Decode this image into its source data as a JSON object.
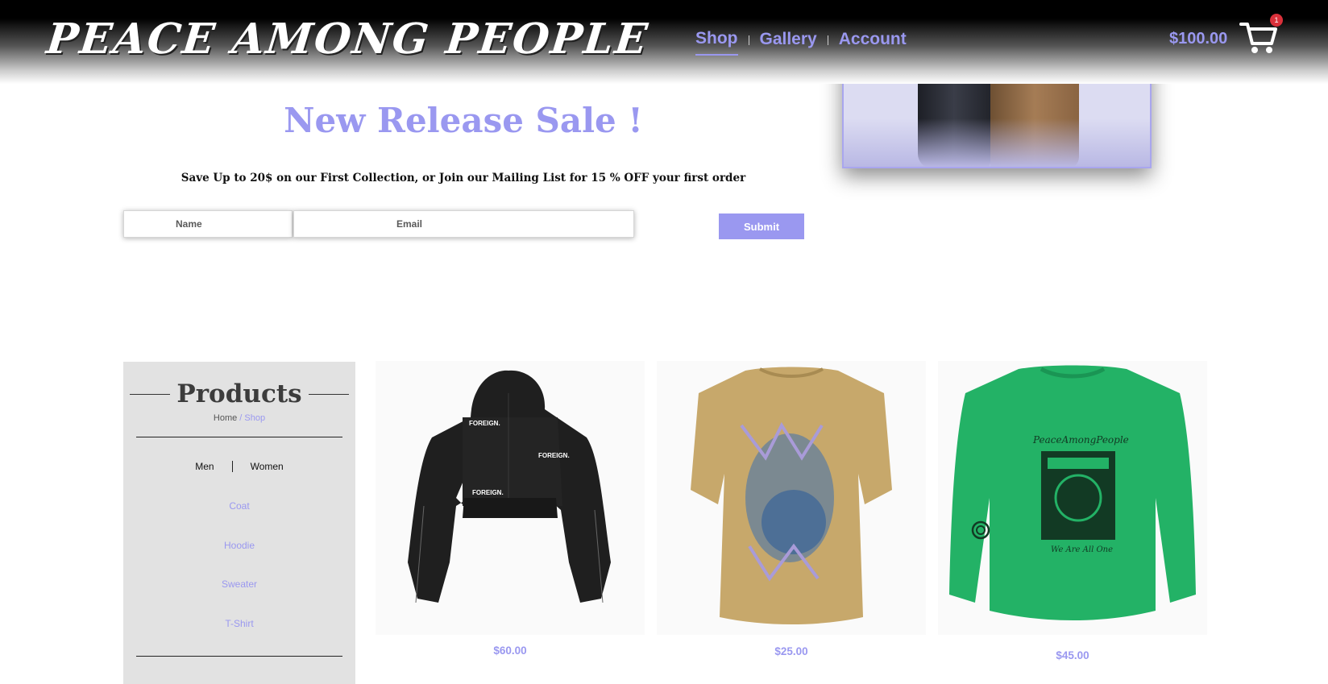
{
  "header": {
    "logo_text": "PEACE AMONG PEOPLE",
    "nav": [
      {
        "label": "Shop",
        "active": true
      },
      {
        "label": "Gallery",
        "active": false
      },
      {
        "label": "Account",
        "active": false
      }
    ],
    "cart_total": "$100.00",
    "cart_count": "1"
  },
  "sale": {
    "title": "New Release Sale !",
    "subtitle": "Save Up to 20$ on our First Collection, or Join our Mailing List for 15 % OFF your first order",
    "name_placeholder": "Name",
    "email_placeholder": "Email",
    "submit_label": "Submit"
  },
  "sidebar": {
    "title": "Products",
    "breadcrumb_home": "Home",
    "breadcrumb_sep": " / ",
    "breadcrumb_current": "Shop",
    "gender": [
      "Men",
      "Women"
    ],
    "categories": [
      "Coat",
      "Hoodie",
      "Sweater",
      "T-Shirt"
    ]
  },
  "products": [
    {
      "price": "$60.00",
      "print_text": "FOREIGN.",
      "color": "#1f1f1f"
    },
    {
      "price": "$25.00",
      "color": "#c7a86b"
    },
    {
      "price": "$45.00",
      "print_text": "PeaceAmongPeople",
      "print_text_2": "We Are All One",
      "color": "#23b266"
    }
  ],
  "colors": {
    "accent": "#9a98f0",
    "sidebar_bg": "#e2e2e2",
    "badge": "#d9303a"
  }
}
